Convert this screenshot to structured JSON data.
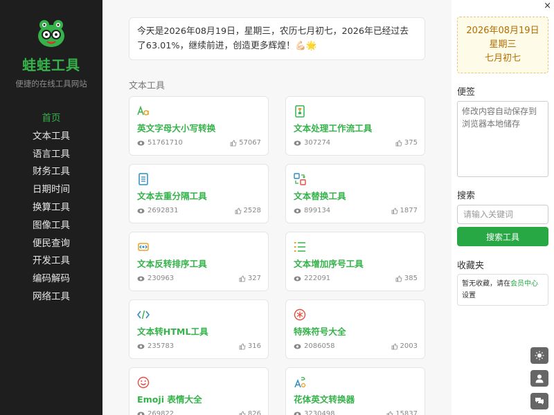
{
  "sidebar": {
    "brand": "蛙蛙工具",
    "slogan": "便捷的在线工具网站",
    "nav": [
      "首页",
      "文本工具",
      "语言工具",
      "财务工具",
      "日期时间",
      "换算工具",
      "图像工具",
      "便民查询",
      "开发工具",
      "编码解码",
      "网络工具"
    ]
  },
  "main": {
    "banner": "今天是2026年08月19日，星期三，农历七月初七，2026年已经过去了63.01%，继续前进，创造更多辉煌！💪🏻🌟",
    "section_title": "文本工具",
    "cards": [
      {
        "icon": "letter-case-icon",
        "title": "英文字母大小写转换",
        "views": "51761710",
        "likes": "57067"
      },
      {
        "icon": "workflow-icon",
        "title": "文本处理工作流工具",
        "views": "307274",
        "likes": "375"
      },
      {
        "icon": "document-lines-icon",
        "title": "文本去重分隔工具",
        "views": "2692831",
        "likes": "2528"
      },
      {
        "icon": "replace-icon",
        "title": "文本替换工具",
        "views": "899134",
        "likes": "1877"
      },
      {
        "icon": "reverse-sort-icon",
        "title": "文本反转排序工具",
        "views": "230963",
        "likes": "327"
      },
      {
        "icon": "numbered-list-icon",
        "title": "文本增加序号工具",
        "views": "222091",
        "likes": "385"
      },
      {
        "icon": "code-icon",
        "title": "文本转HTML工具",
        "views": "235783",
        "likes": "316"
      },
      {
        "icon": "asterisk-icon",
        "title": "特殊符号大全",
        "views": "2086058",
        "likes": "2003"
      },
      {
        "icon": "smiley-icon",
        "title": "Emoji 表情大全",
        "views": "269822",
        "likes": "826"
      },
      {
        "icon": "fancy-letter-icon",
        "title": "花体英文转换器",
        "views": "3230498",
        "likes": "15837"
      }
    ]
  },
  "right": {
    "close": "×",
    "date": "2026年08月19日",
    "weekday": "星期三",
    "lunar": "七月初七",
    "note_label": "便签",
    "note_placeholder": "修改内容自动保存到浏览器本地储存",
    "search_label": "搜索",
    "search_placeholder": "请输入关键词",
    "search_button": "搜索工具",
    "fav_label": "收藏夹",
    "fav_prefix": "暂无收藏，请在",
    "fav_link": "会员中心",
    "fav_suffix": "设置"
  },
  "colors": {
    "accent": "#35b34a",
    "sidebar_bg": "#1e1e1e",
    "button": "#28a745"
  }
}
